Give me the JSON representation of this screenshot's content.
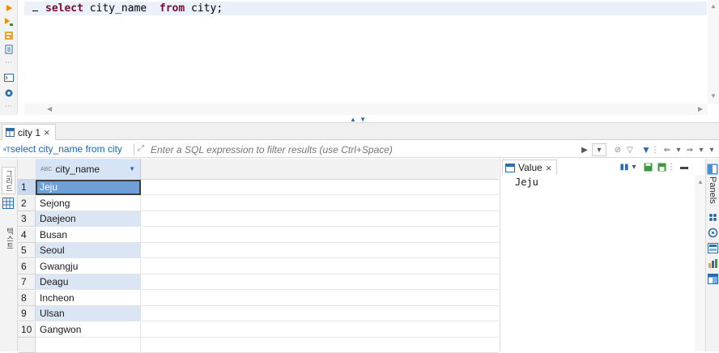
{
  "editor": {
    "sql_keyword_select": "select",
    "sql_column": " city_name  ",
    "sql_keyword_from": "from",
    "sql_table": " city;",
    "gutter_icons": [
      "execute-statement-icon",
      "execute-script-icon",
      "explain-plan-icon",
      "load-script-icon",
      "terminal-icon",
      "settings-icon"
    ]
  },
  "results_tab": {
    "label": "city 1",
    "close": "×"
  },
  "filter_bar": {
    "query_label": "select city_name from city",
    "query_badge": "ᵃT",
    "placeholder": "Enter a SQL expression to filter results (use Ctrl+Space)"
  },
  "left_toolbar": {
    "grid_label": "그리드",
    "text_label": "텍스트"
  },
  "grid": {
    "column_header": "city_name",
    "column_type_badge": "ABC",
    "rows": [
      {
        "num": "1",
        "value": "Jeju"
      },
      {
        "num": "2",
        "value": "Sejong"
      },
      {
        "num": "3",
        "value": "Daejeon"
      },
      {
        "num": "4",
        "value": "Busan"
      },
      {
        "num": "5",
        "value": "Seoul"
      },
      {
        "num": "6",
        "value": "Gwangju"
      },
      {
        "num": "7",
        "value": "Deagu"
      },
      {
        "num": "8",
        "value": "Incheon"
      },
      {
        "num": "9",
        "value": "Ulsan"
      },
      {
        "num": "10",
        "value": "Gangwon"
      }
    ],
    "selected_row": 1
  },
  "value_panel": {
    "tab_label": "Value",
    "close": "×",
    "content": "Jeju"
  },
  "right_strip": {
    "panels_label": "Panels"
  },
  "colors": {
    "selection": "#6e9fd6",
    "alt_row": "#dbe6f4",
    "keyword": "#7a0d2e",
    "filter_query": "#1c63b7"
  }
}
